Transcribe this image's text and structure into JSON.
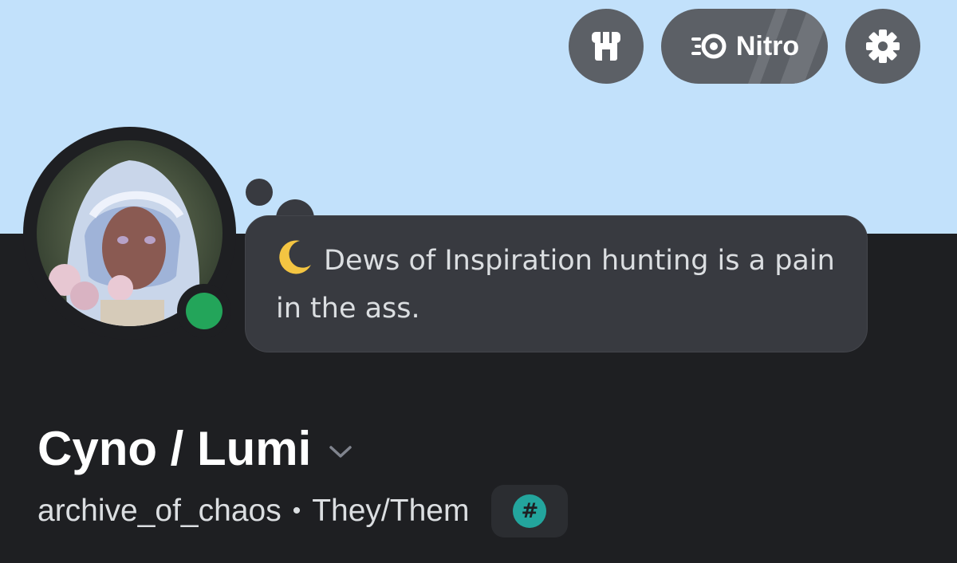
{
  "colors": {
    "banner": "#c2e1fb",
    "background": "#1e1f22",
    "bubble": "#383a40",
    "online_status": "#23a55a",
    "badge_teal": "#23a59d",
    "toolbar_button": "#5c6066"
  },
  "toolbar": {
    "shop_icon": "shop-icon",
    "nitro_icon": "nitro-icon",
    "nitro_label": "Nitro",
    "settings_icon": "gear-icon"
  },
  "profile": {
    "status": "online",
    "custom_status": {
      "emoji": "crescent-moon",
      "text": "Dews of Inspiration hunting is a pain in the ass."
    },
    "display_name": "Cyno / Lumi",
    "username": "archive_of_chaos",
    "separator": "•",
    "pronouns": "They/Them",
    "badge": "#"
  }
}
